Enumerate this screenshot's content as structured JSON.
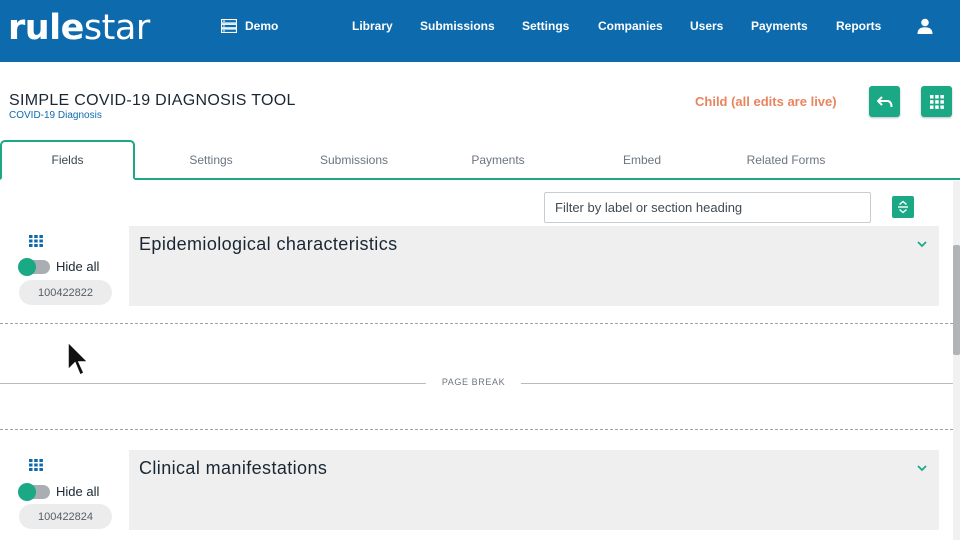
{
  "app": {
    "logo_bold": "rule",
    "logo_light": "star",
    "workspace": "Demo"
  },
  "nav": {
    "items": [
      {
        "label": "Library"
      },
      {
        "label": "Submissions"
      },
      {
        "label": "Settings"
      },
      {
        "label": "Companies"
      },
      {
        "label": "Users"
      },
      {
        "label": "Payments"
      },
      {
        "label": "Reports"
      }
    ],
    "user_icon": "user-icon"
  },
  "header": {
    "title": "SIMPLE COVID-19 DIAGNOSIS TOOL",
    "subtitle": "COVID-19 Diagnosis",
    "status": "Child (all edits are live)",
    "undo_icon": "undo-icon",
    "apps_icon": "grid-icon"
  },
  "tabs": [
    {
      "label": "Fields",
      "active": true
    },
    {
      "label": "Settings"
    },
    {
      "label": "Submissions"
    },
    {
      "label": "Payments"
    },
    {
      "label": "Embed"
    },
    {
      "label": "Related Forms"
    }
  ],
  "filter": {
    "placeholder": "Filter by label or section heading",
    "value": ""
  },
  "sections": [
    {
      "heading": "Epidemiological characteristics",
      "hide_label": "Hide all",
      "id": "100422822"
    },
    {
      "heading": "Clinical manifestations",
      "hide_label": "Hide all",
      "id": "100422824"
    }
  ],
  "page_break": {
    "label": "PAGE BREAK"
  },
  "colors": {
    "brand_blue": "#0d6aad",
    "accent_green": "#1aa885",
    "status_orange": "#e8845e"
  }
}
